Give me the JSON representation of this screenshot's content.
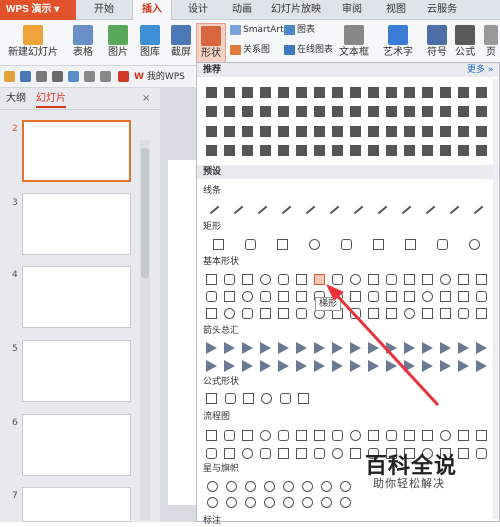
{
  "app": {
    "title": "WPS 演示"
  },
  "tabs": [
    "开始",
    "插入",
    "设计",
    "动画",
    "幻灯片放映",
    "审阅",
    "视图",
    "云服务"
  ],
  "active_tab": 1,
  "ribbon": {
    "new_slide": "新建幻灯片",
    "table": "表格",
    "picture": "图片",
    "gallery": "图库",
    "screenshot": "截屏",
    "shape": "形状",
    "smartart": "SmartArt",
    "chart": "图表",
    "relation": "关系图",
    "online_chart": "在线图表",
    "textbox": "文本框",
    "wordart": "艺术字",
    "symbol": "符号",
    "formula": "公式",
    "extra": "页"
  },
  "quickbar": {
    "doc_tab": "我的WPS"
  },
  "left_panel": {
    "tab_outline": "大纲",
    "tab_slides": "幻灯片",
    "close": "×",
    "slide_numbers": [
      "2",
      "3",
      "4",
      "5",
      "6",
      "7"
    ]
  },
  "dropdown": {
    "recommended": "推荐",
    "more": "更多 »",
    "preset": "预设",
    "sections": [
      "线条",
      "矩形",
      "基本形状",
      "箭头总汇",
      "公式形状",
      "流程图",
      "星与旗帜",
      "标注"
    ],
    "tooltip": "梯形"
  },
  "watermark": {
    "title": "百科全说",
    "subtitle": "助你轻松解决"
  },
  "colors": {
    "accent": "#e3532b",
    "arrow": "#e8333a",
    "active_tab": "#d4381b"
  }
}
